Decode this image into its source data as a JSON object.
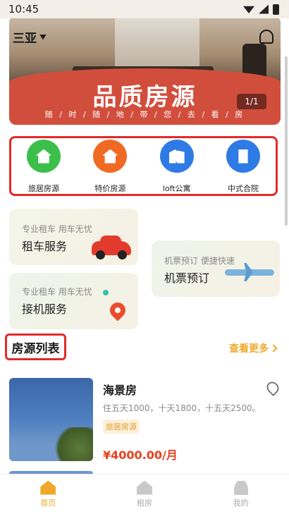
{
  "status_bar": {
    "time": "10:45"
  },
  "location": "三亚",
  "banner": {
    "title": "品质房源",
    "subtitle": "随 / 时 / 随 / 地 / 带 / 您 / 去 / 看 / 房",
    "counter": "1/1"
  },
  "categories": [
    {
      "label": "旅居房源",
      "color": "#3bbf4a",
      "icon": "refresh-house-icon"
    },
    {
      "label": "特价房源",
      "color": "#f06a23",
      "icon": "house-icon"
    },
    {
      "label": "loft公寓",
      "color": "#2f7be5",
      "icon": "buildings-icon"
    },
    {
      "label": "中式合院",
      "color": "#2f7be5",
      "icon": "courtyard-icon"
    }
  ],
  "services": {
    "car": {
      "small": "专业租车 用车无忧",
      "big": "租车服务"
    },
    "ticket": {
      "small": "机票预订 便捷快速",
      "big": "机票预订"
    },
    "pickup": {
      "small": "专业租车 用车无忧",
      "big": "接机服务"
    }
  },
  "list": {
    "title": "房源列表",
    "more": "查看更多"
  },
  "houses": [
    {
      "name": "海景房",
      "desc": "住五天1000，十天1800，十五天2500。",
      "tag": "旅居房源",
      "price": "¥4000.00/月"
    }
  ],
  "tabs": [
    {
      "label": "首页",
      "active": true
    },
    {
      "label": "租房",
      "active": false
    },
    {
      "label": "我的",
      "active": false
    }
  ],
  "colors": {
    "accent": "#f0a82b",
    "highlight_border": "#e22a2a",
    "price": "#e8401c"
  }
}
